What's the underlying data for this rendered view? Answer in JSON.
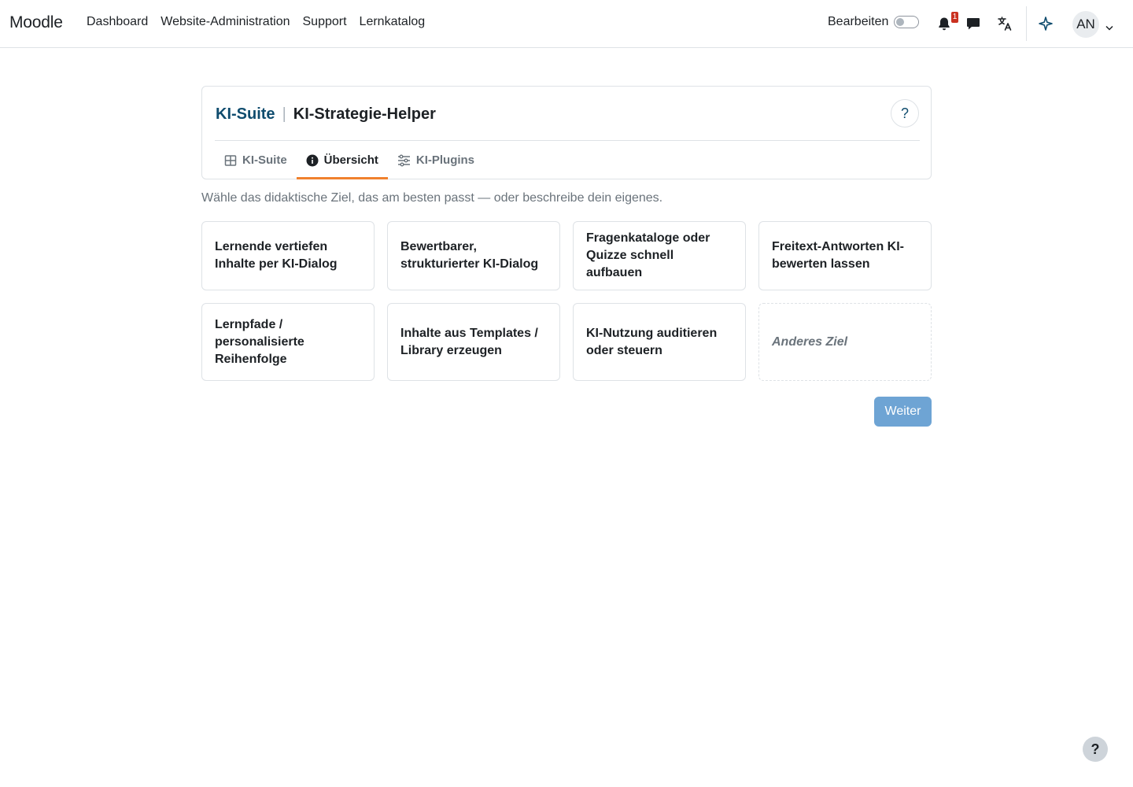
{
  "brand": "Moodle",
  "nav": {
    "items": [
      "Dashboard",
      "Website-Administration",
      "Support",
      "Lernkatalog"
    ],
    "edit_mode_label": "Bearbeiten",
    "notification_count": "1",
    "user_initials": "AN"
  },
  "header": {
    "suite_label": "KI-Suite",
    "separator": "|",
    "page_title": "KI-Strategie-Helper",
    "help_label": "?"
  },
  "tabs": [
    {
      "label": "KI-Suite",
      "icon": "grid-icon",
      "active": false
    },
    {
      "label": "Übersicht",
      "icon": "info-icon",
      "active": true
    },
    {
      "label": "KI-Plugins",
      "icon": "sliders-icon",
      "active": false
    }
  ],
  "intro": "Wähle das didaktische Ziel, das am besten passt — oder beschreibe dein eigenes.",
  "goals": [
    "Lernende vertiefen Inhalte per KI-Dialog",
    "Bewertbarer, strukturierter KI-Dialog",
    "Fragenkataloge oder Quizze schnell aufbauen",
    "Freitext-Antworten KI-bewerten lassen",
    "Lernpfade / personalisierte Reihenfolge",
    "Inhalte aus Templates / Library erzeugen",
    "KI-Nutzung auditieren oder steuern",
    "Anderes Ziel"
  ],
  "next_button": "Weiter",
  "footer_help": "?",
  "colors": {
    "accent": "#0f4c6e",
    "tab_underline": "#f0812d",
    "primary_button": "#6ea4d4",
    "badge": "#ca3120"
  }
}
